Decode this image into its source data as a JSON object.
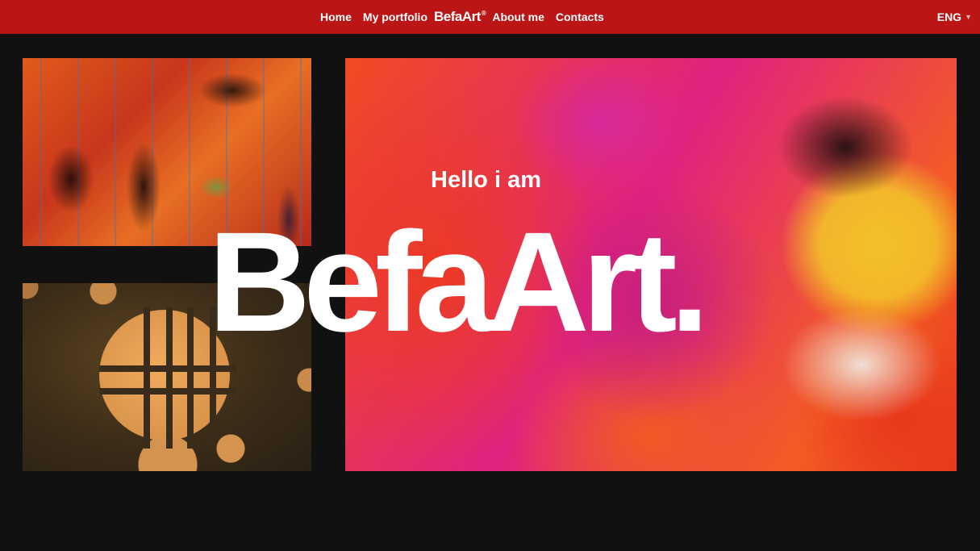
{
  "nav": {
    "home": "Home",
    "portfolio": "My portfolio",
    "logo": "BefaArt",
    "logo_mark": "®",
    "about": "About me",
    "contacts": "Contacts",
    "language": "ENG",
    "language_chevron_icon": "chevron-down-icon"
  },
  "hero": {
    "greeting": "Hello i am",
    "name": "BefaArt."
  },
  "gallery": {
    "items": [
      "drip-painting",
      "circles-painting",
      "fluid-painting"
    ]
  },
  "colors": {
    "navbar": "#bb1515",
    "background": "#111111",
    "text": "#ffffff"
  }
}
